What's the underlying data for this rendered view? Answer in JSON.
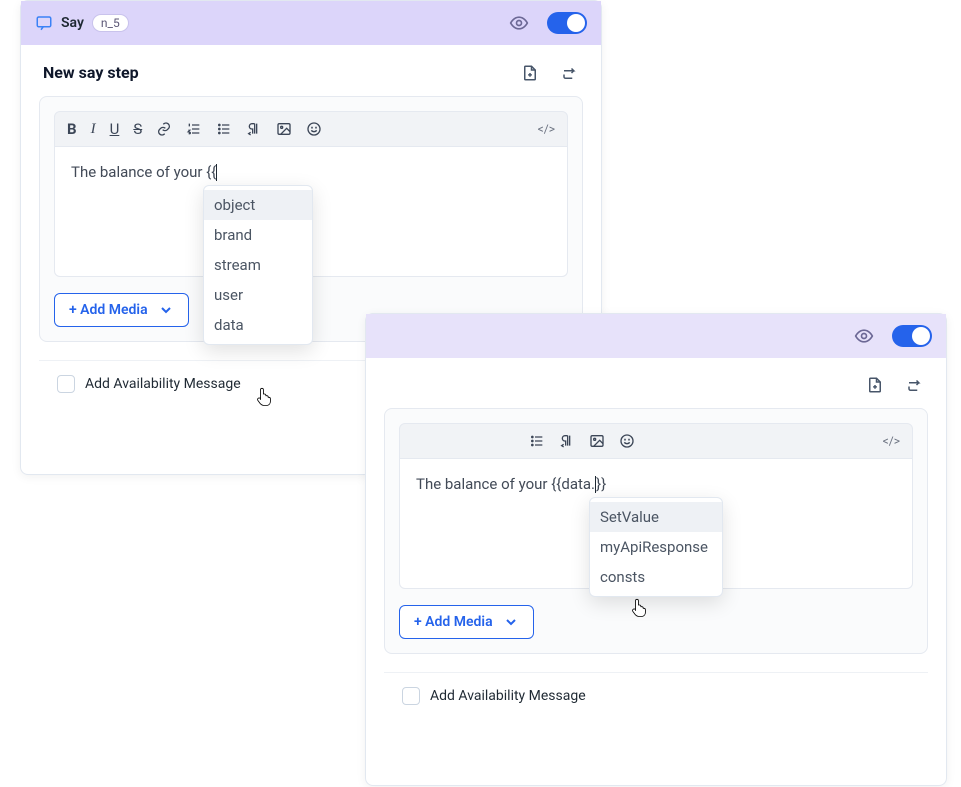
{
  "panelA": {
    "header": {
      "title": "Say",
      "badge": "n_5"
    },
    "sub": {
      "title": "New say step"
    },
    "editor": {
      "prefix": "The balance of your ",
      "token": "{{"
    },
    "autocomplete": {
      "items": [
        "object",
        "brand",
        "stream",
        "user",
        "data"
      ],
      "selectedIndex": 0
    },
    "addMedia": "+ Add Media",
    "availability": "Add Availability Message"
  },
  "panelB": {
    "editor": {
      "prefix": "The balance of your ",
      "token": "{{data.",
      "suffix": "}}"
    },
    "autocomplete": {
      "items": [
        "SetValue",
        "myApiResponse",
        "consts"
      ],
      "selectedIndex": 0
    },
    "addMedia": "+ Add Media",
    "availability": "Add Availability Message"
  },
  "toolbar": {
    "code": "</>"
  }
}
